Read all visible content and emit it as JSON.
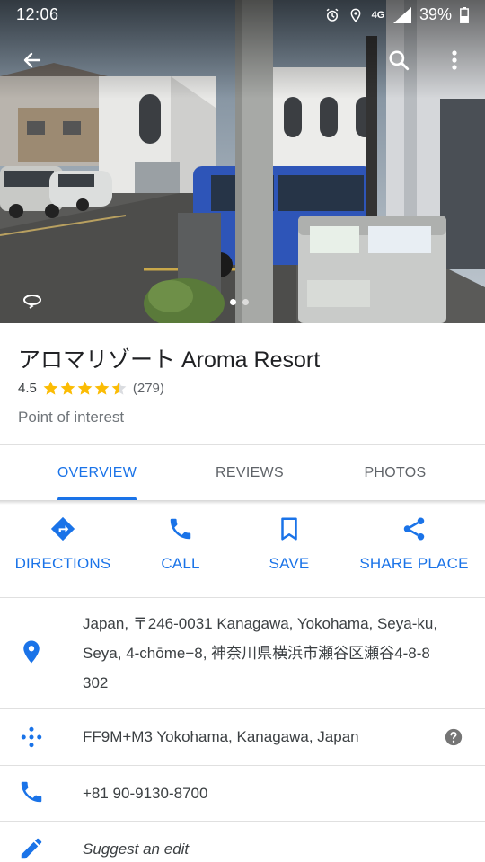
{
  "status_bar": {
    "time": "12:06",
    "network": "4G",
    "battery": "39%"
  },
  "hero": {
    "photo_count": 2,
    "active_photo": 1
  },
  "place": {
    "name": "アロマリゾート Aroma Resort",
    "rating": "4.5",
    "rating_value": 4.5,
    "review_count": "(279)",
    "category": "Point of interest"
  },
  "tabs": [
    {
      "label": "OVERVIEW",
      "active": true
    },
    {
      "label": "REVIEWS",
      "active": false
    },
    {
      "label": "PHOTOS",
      "active": false
    }
  ],
  "actions": [
    {
      "label": "DIRECTIONS",
      "icon": "directions-icon"
    },
    {
      "label": "CALL",
      "icon": "phone-icon"
    },
    {
      "label": "SAVE",
      "icon": "bookmark-icon"
    },
    {
      "label": "SHARE PLACE",
      "icon": "share-icon"
    }
  ],
  "details": {
    "address_lines": [
      "Japan, 〒246-0031 Kanagawa, Yokohama, Seya-ku,",
      "Seya, 4-chōme−8, 神奈川県横浜市瀬谷区瀬谷4-8-8",
      "302"
    ],
    "plus_code": "FF9M+M3 Yokohama, Kanagawa, Japan",
    "phone": "+81 90-9130-8700",
    "suggest_edit": "Suggest an edit"
  },
  "colors": {
    "accent": "#1a73e8",
    "star": "#fbbc04",
    "text_secondary": "#70757a"
  }
}
